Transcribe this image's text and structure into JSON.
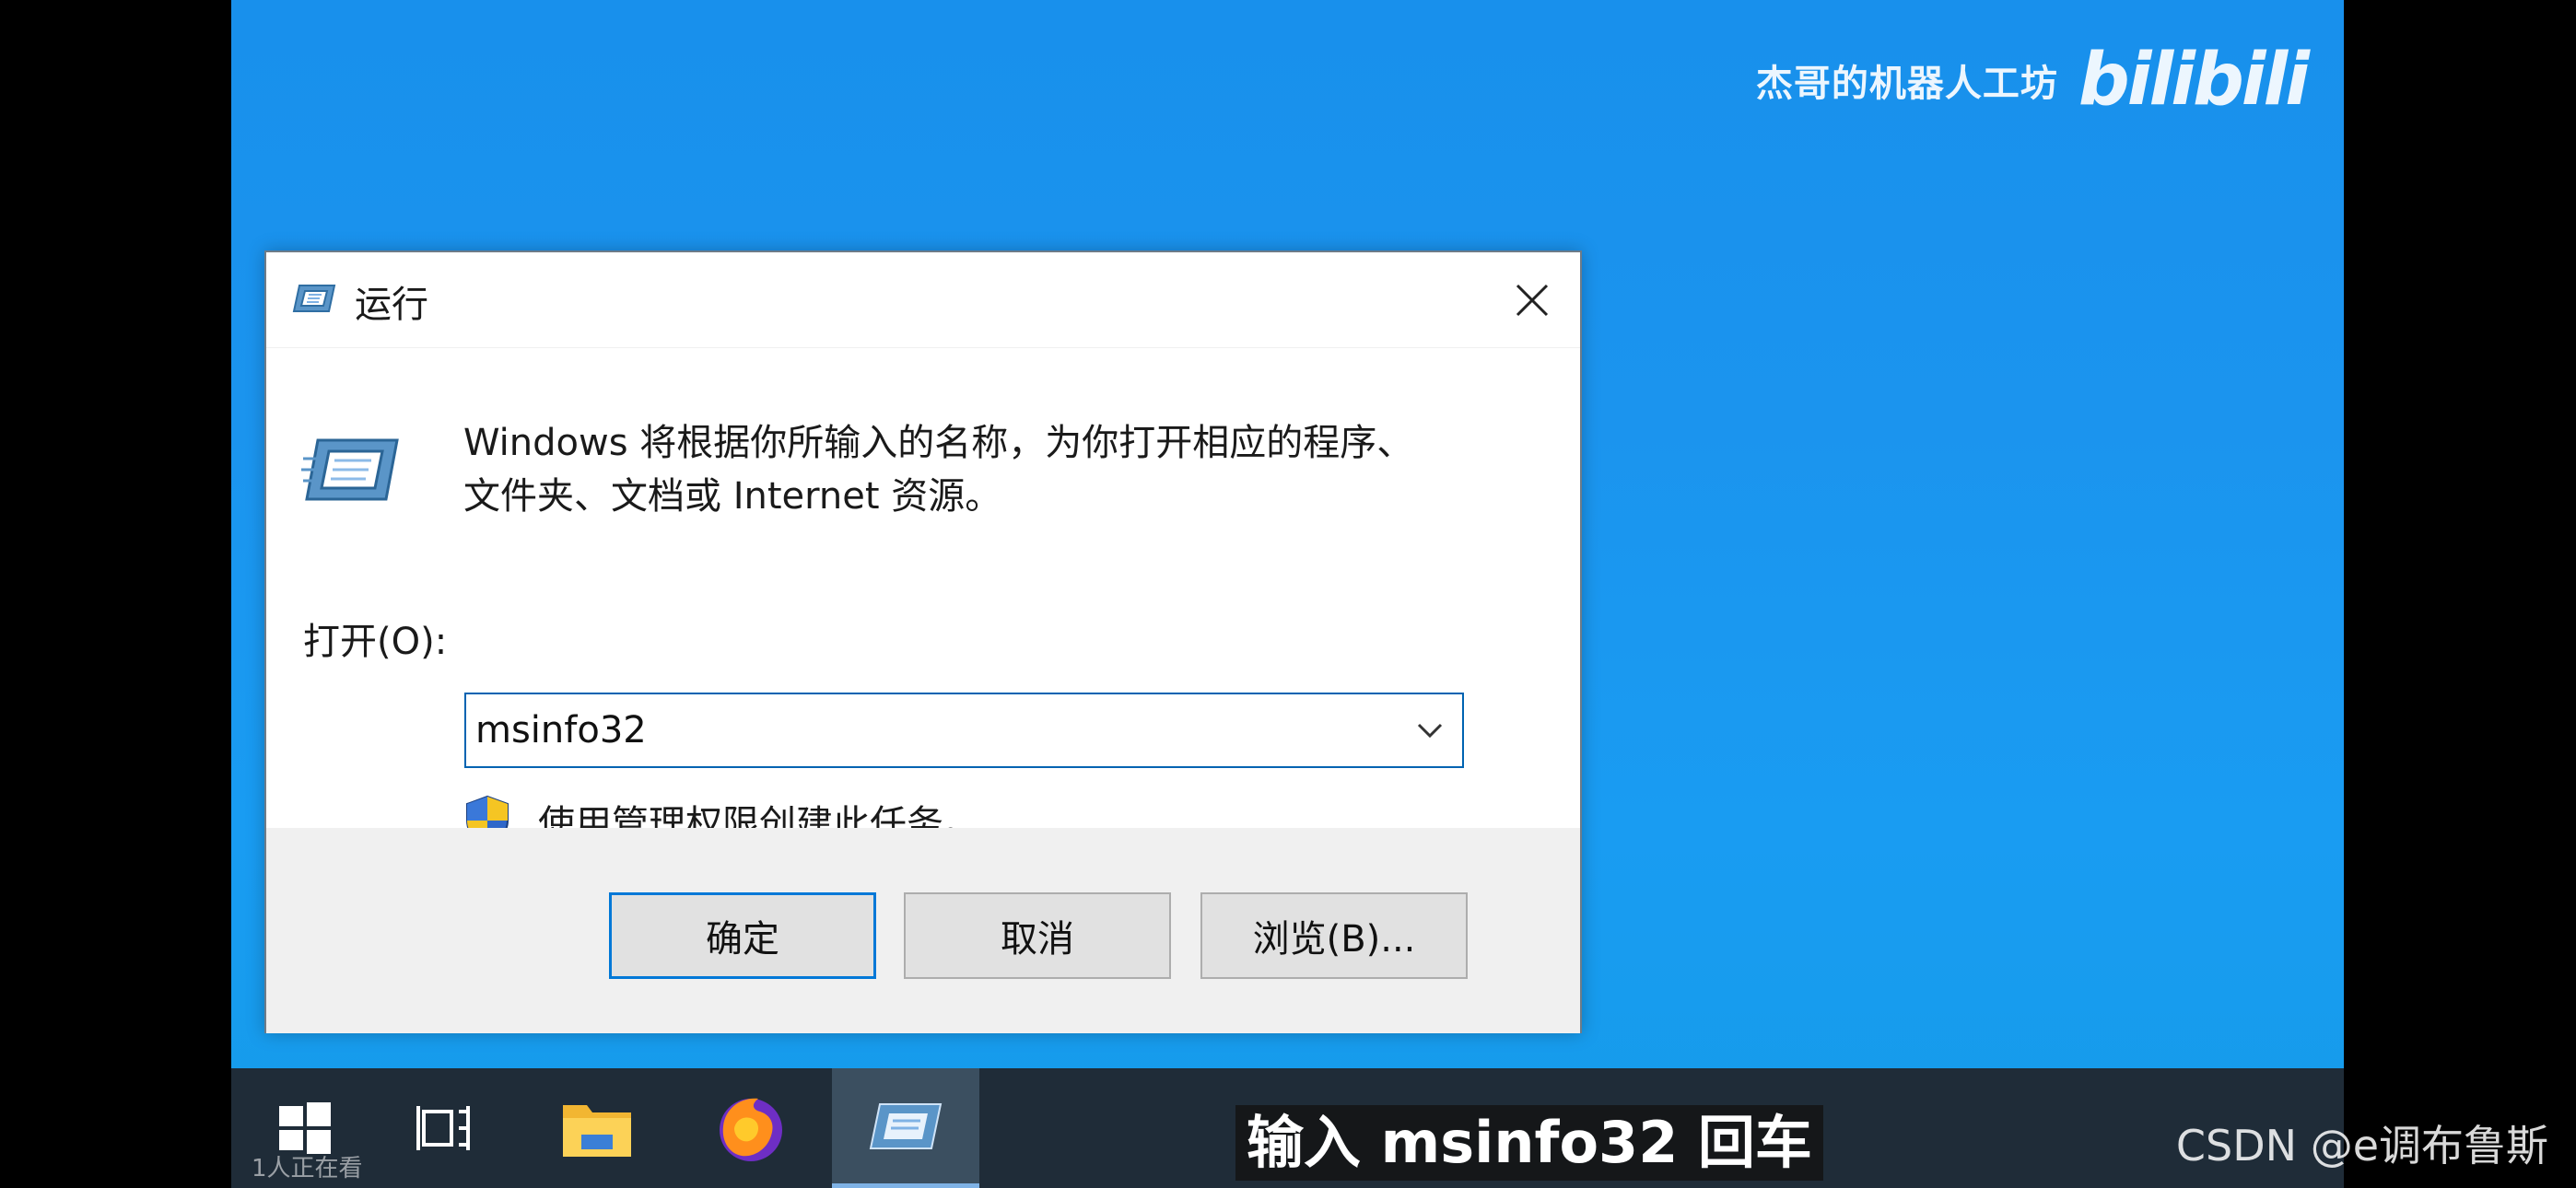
{
  "watermark": {
    "channel": "杰哥的机器人工坊",
    "logo": "bilibili"
  },
  "dialog": {
    "title": "运行",
    "description_line1": "Windows 将根据你所输入的名称，为你打开相应的程序、",
    "description_line2": "文件夹、文档或 Internet 资源。",
    "open_label": "打开(O):",
    "open_value": "msinfo32",
    "admin_text": "使用管理权限创建此任务。",
    "buttons": {
      "ok": "确定",
      "cancel": "取消",
      "browse": "浏览(B)..."
    }
  },
  "taskbar": {
    "viewers": "1人正在看"
  },
  "subtitle": "输入 msinfo32 回车",
  "csdn_watermark": "CSDN @e调布鲁斯",
  "colors": {
    "desktop": "#1b94ee",
    "taskbar": "#1f2c38",
    "accent": "#0078d7"
  }
}
